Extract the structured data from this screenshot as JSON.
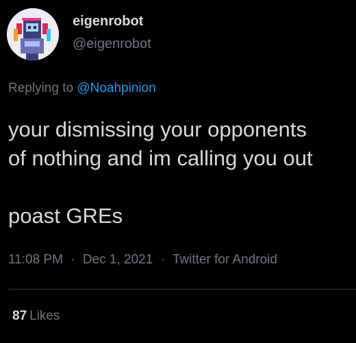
{
  "author": {
    "display_name": "eigenrobot",
    "handle": "@eigenrobot",
    "avatar_icon": "robot-avatar-icon"
  },
  "reply": {
    "prefix": "Replying to",
    "mention": "@Noahpinion"
  },
  "tweet": {
    "lines": [
      "your dismissing your opponents",
      "of nothing and im calling you out"
    ],
    "line3": "poast GREs"
  },
  "meta": {
    "time": "11:08 PM",
    "separator": "·",
    "date": "Dec 1, 2021",
    "source": "Twitter for Android"
  },
  "stats": {
    "likes_count": "87",
    "likes_label": "Likes"
  },
  "colors": {
    "background": "#000000",
    "text": "#d9d9d9",
    "secondary": "#6e767d",
    "link": "#1d9bf0"
  }
}
